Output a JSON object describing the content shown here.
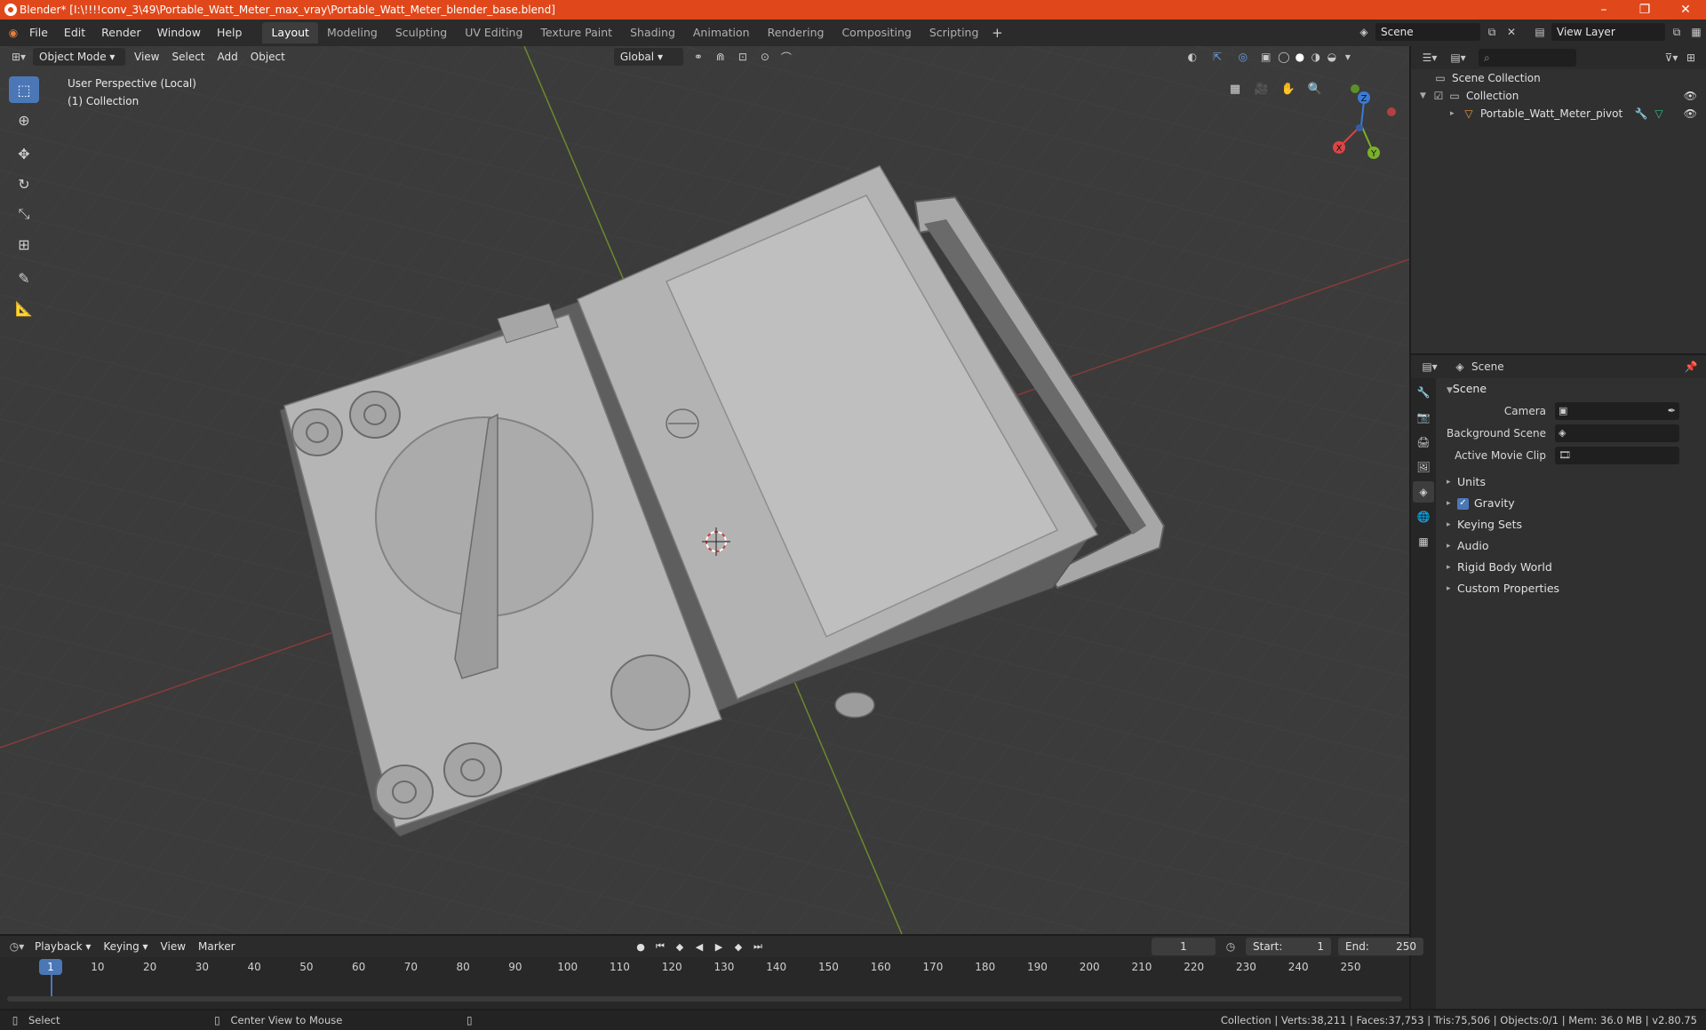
{
  "window": {
    "title": "Blender* [I:\\!!!!conv_3\\49\\Portable_Watt_Meter_max_vray\\Portable_Watt_Meter_blender_base.blend]",
    "min": "–",
    "max": "❐",
    "close": "✕"
  },
  "menu": [
    "File",
    "Edit",
    "Render",
    "Window",
    "Help"
  ],
  "workspaces": [
    "Layout",
    "Modeling",
    "Sculpting",
    "UV Editing",
    "Texture Paint",
    "Shading",
    "Animation",
    "Rendering",
    "Compositing",
    "Scripting"
  ],
  "active_workspace": "Layout",
  "scene_selector": "Scene",
  "view_layer": "View Layer",
  "viewport": {
    "mode": "Object Mode",
    "menus": [
      "View",
      "Select",
      "Add",
      "Object"
    ],
    "transform_orientation": "Global",
    "info_line1": "User Perspective (Local)",
    "info_line2": "(1) Collection",
    "axis_x": "X",
    "axis_y": "Y",
    "axis_z": "Z"
  },
  "outliner": {
    "root": "Scene Collection",
    "collection": "Collection",
    "object": "Portable_Watt_Meter_pivot"
  },
  "properties": {
    "header": "Scene",
    "section": "Scene",
    "camera_label": "Camera",
    "bg_scene_label": "Background Scene",
    "movie_clip_label": "Active Movie Clip",
    "panels": [
      "Units",
      "Gravity",
      "Keying Sets",
      "Audio",
      "Rigid Body World",
      "Custom Properties"
    ]
  },
  "timeline": {
    "menus": [
      "Playback",
      "Keying",
      "View",
      "Marker"
    ],
    "current_frame": "1",
    "start_label": "Start:",
    "start": "1",
    "end_label": "End:",
    "end": "250",
    "ticks": [
      "10",
      "20",
      "30",
      "40",
      "50",
      "60",
      "70",
      "80",
      "90",
      "100",
      "110",
      "120",
      "130",
      "140",
      "150",
      "160",
      "170",
      "180",
      "190",
      "200",
      "210",
      "220",
      "230",
      "240",
      "250"
    ]
  },
  "status": {
    "select": "Select",
    "center": "Center View to Mouse",
    "stats": "Collection | Verts:38,211 | Faces:37,753 | Tris:75,506 | Objects:0/1 | Mem: 36.0 MB | v2.80.75"
  }
}
